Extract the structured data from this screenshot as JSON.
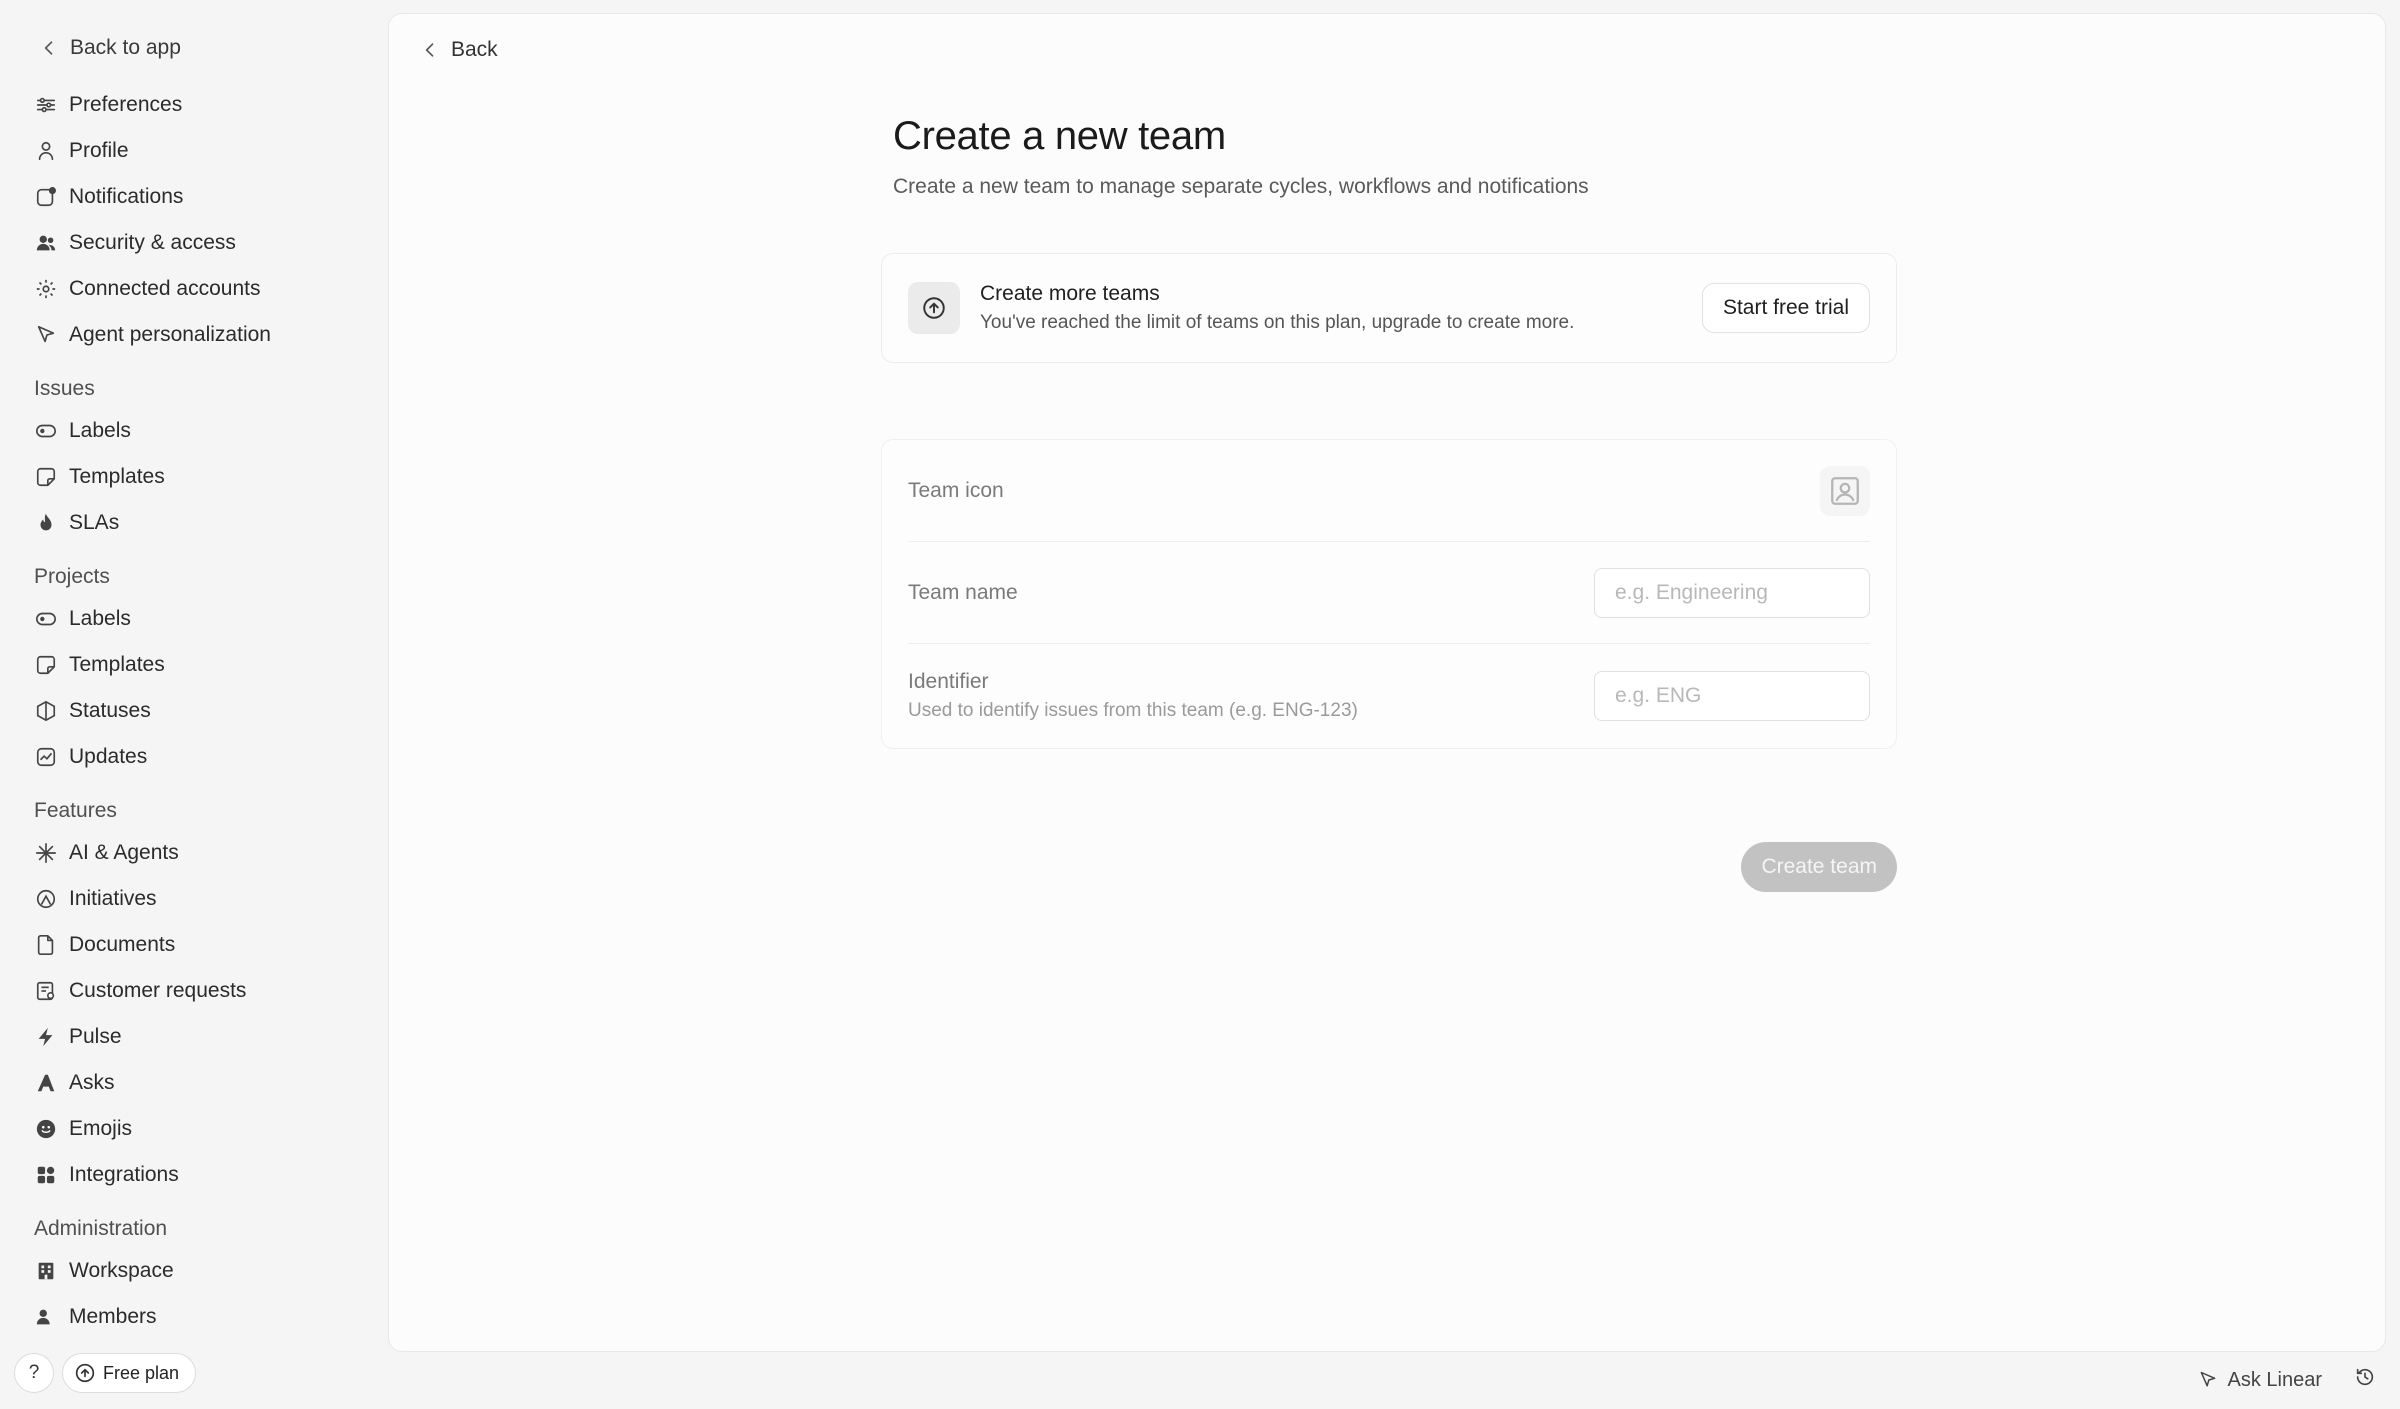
{
  "sidebar": {
    "back_to_app": "Back to app",
    "account_items": [
      {
        "label": "Preferences",
        "icon": "sliders-icon"
      },
      {
        "label": "Profile",
        "icon": "user-icon"
      },
      {
        "label": "Notifications",
        "icon": "notification-icon"
      },
      {
        "label": "Security & access",
        "icon": "users-icon"
      },
      {
        "label": "Connected accounts",
        "icon": "gear-icon"
      },
      {
        "label": "Agent personalization",
        "icon": "cursor-icon"
      }
    ],
    "issues": {
      "title": "Issues",
      "items": [
        {
          "label": "Labels",
          "icon": "tag-icon"
        },
        {
          "label": "Templates",
          "icon": "note-icon"
        },
        {
          "label": "SLAs",
          "icon": "flame-icon"
        }
      ]
    },
    "projects": {
      "title": "Projects",
      "items": [
        {
          "label": "Labels",
          "icon": "tag-icon"
        },
        {
          "label": "Templates",
          "icon": "note-icon"
        },
        {
          "label": "Statuses",
          "icon": "hexagon-icon"
        },
        {
          "label": "Updates",
          "icon": "chart-icon"
        }
      ]
    },
    "features": {
      "title": "Features",
      "items": [
        {
          "label": "AI & Agents",
          "icon": "sparkle-icon"
        },
        {
          "label": "Initiatives",
          "icon": "initiative-icon"
        },
        {
          "label": "Documents",
          "icon": "document-icon"
        },
        {
          "label": "Customer requests",
          "icon": "request-icon"
        },
        {
          "label": "Pulse",
          "icon": "pulse-icon"
        },
        {
          "label": "Asks",
          "icon": "asks-icon"
        },
        {
          "label": "Emojis",
          "icon": "emoji-icon"
        },
        {
          "label": "Integrations",
          "icon": "grid-icon"
        }
      ]
    },
    "administration": {
      "title": "Administration",
      "items": [
        {
          "label": "Workspace",
          "icon": "building-icon"
        },
        {
          "label": "Members",
          "icon": "members-icon"
        }
      ]
    },
    "help_label": "?",
    "plan_label": "Free plan"
  },
  "main": {
    "back_label": "Back",
    "title": "Create a new team",
    "subtitle": "Create a new team to manage separate cycles, workflows and notifications",
    "upsell": {
      "title": "Create more teams",
      "description": "You've reached the limit of teams on this plan, upgrade to create more.",
      "button": "Start free trial"
    },
    "form": {
      "team_icon_label": "Team icon",
      "team_name_label": "Team name",
      "team_name_placeholder": "e.g. Engineering",
      "team_name_value": "",
      "identifier_label": "Identifier",
      "identifier_hint": "Used to identify issues from this team (e.g. ENG-123)",
      "identifier_placeholder": "e.g. ENG",
      "identifier_value": ""
    },
    "create_button": "Create team"
  },
  "footer": {
    "ask_label": "Ask Linear"
  },
  "colors": {
    "background": "#f5f5f5",
    "panel": "#fcfcfc",
    "disabled_button": "#c2c2c2"
  }
}
